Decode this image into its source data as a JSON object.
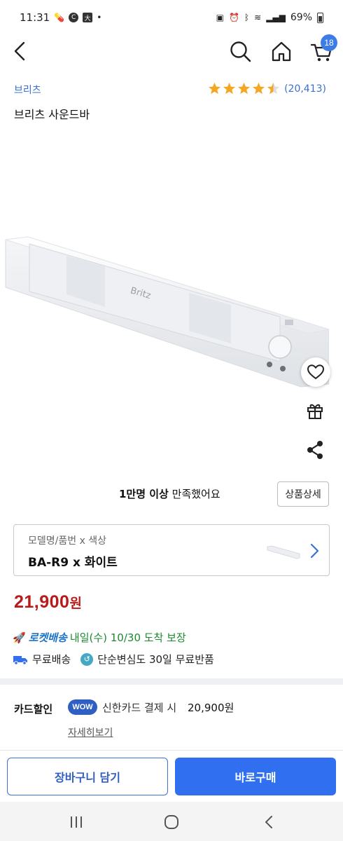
{
  "status_bar": {
    "time": "11:31",
    "battery": "69%"
  },
  "nav": {
    "cart_count": "18",
    "icons": [
      "back-icon",
      "search-icon",
      "home-icon",
      "cart-icon"
    ]
  },
  "product": {
    "brand": "브리츠",
    "title": "브리츠 사운드바",
    "rating": 4.5,
    "review_count": "(20,413)",
    "image_brand_text": "Britz"
  },
  "satisfaction": {
    "strong": "1만명 이상",
    "rest": " 만족했어요",
    "detail_button": "상품상세"
  },
  "option": {
    "label": "모델명/품번 x 색상",
    "value": "BA-R9 x 화이트"
  },
  "price": {
    "amount": "21,900",
    "unit": "원"
  },
  "delivery": {
    "rocket_label": "로켓배송",
    "rocket_date": "내일(수) 10/30 도착 보장",
    "free_shipping": "무료배송",
    "free_return": "단순변심도 30일 무료반품"
  },
  "card_discount": {
    "title": "카드할인",
    "badge": "WOW",
    "text": "신한카드 결제 시",
    "price": "20,900원",
    "more": "자세히보기"
  },
  "actions": {
    "cart": "장바구니 담기",
    "buy": "바로구매"
  },
  "colors": {
    "accent": "#2f6ff0",
    "price": "#b91b1b",
    "rocket": "#1a73c9",
    "arrival": "#1b8a2e",
    "star": "#f5a623"
  }
}
